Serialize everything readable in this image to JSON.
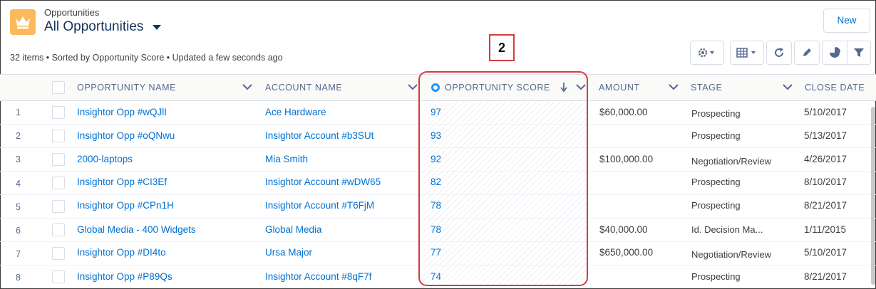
{
  "header": {
    "object_label": "Opportunities",
    "view_title": "All Opportunities",
    "meta": "32 items • Sorted by Opportunity Score • Updated a few seconds ago",
    "new_button": "New"
  },
  "callout": "2",
  "columns": {
    "name": "OPPORTUNITY NAME",
    "account": "ACCOUNT NAME",
    "score": "OPPORTUNITY SCORE",
    "amount": "AMOUNT",
    "stage": "STAGE",
    "close": "CLOSE DATE"
  },
  "rows": [
    {
      "num": "1",
      "name": "Insightor Opp #wQJlI",
      "account": "Ace Hardware",
      "score": "97",
      "amount": "$60,000.00",
      "stage": "Prospecting",
      "close": "5/10/2017"
    },
    {
      "num": "2",
      "name": "Insightor Opp #oQNwu",
      "account": "Insightor Account #b3SUt",
      "score": "93",
      "amount": "",
      "stage": "Prospecting",
      "close": "5/13/2017"
    },
    {
      "num": "3",
      "name": "2000-laptops",
      "account": "Mia Smith",
      "score": "92",
      "amount": "$100,000.00",
      "stage": "Negotiation/Review",
      "close": "4/26/2017"
    },
    {
      "num": "4",
      "name": "Insightor Opp #CI3Ef",
      "account": "Insightor Account #wDW65",
      "score": "82",
      "amount": "",
      "stage": "Prospecting",
      "close": "8/10/2017"
    },
    {
      "num": "5",
      "name": "Insightor Opp #CPn1H",
      "account": "Insightor Account #T6FjM",
      "score": "78",
      "amount": "",
      "stage": "Prospecting",
      "close": "8/21/2017"
    },
    {
      "num": "6",
      "name": "Global Media - 400 Widgets",
      "account": "Global Media",
      "score": "78",
      "amount": "$40,000.00",
      "stage": "Id. Decision Ma...",
      "close": "1/11/2015"
    },
    {
      "num": "7",
      "name": "Insightor Opp #DI4to",
      "account": "Ursa Major",
      "score": "77",
      "amount": "$650,000.00",
      "stage": "Negotiation/Review",
      "close": "5/10/2017"
    },
    {
      "num": "8",
      "name": "Insightor Opp #P89Qs",
      "account": "Insightor Account #8qF7f",
      "score": "74",
      "amount": "",
      "stage": "Prospecting",
      "close": "8/21/2017"
    }
  ],
  "colors": {
    "link": "#0070d2",
    "brand_icon": "#fcb95b",
    "highlight": "#d63b3b",
    "sort_indicator": "#1b96ff"
  },
  "icons": [
    "crown-icon",
    "settings-icon",
    "table-icon",
    "refresh-icon",
    "edit-icon",
    "chart-icon",
    "filter-icon"
  ]
}
